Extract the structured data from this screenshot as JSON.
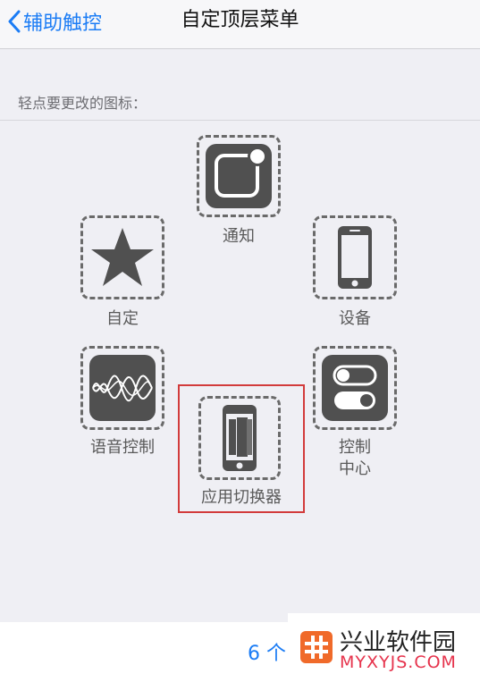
{
  "navbar": {
    "back_label": "辅助触控",
    "title": "自定顶层菜单"
  },
  "section": {
    "label": "轻点要更改的图标："
  },
  "icons": [
    {
      "name": "notification",
      "label": "通知",
      "icon": "notification-icon"
    },
    {
      "name": "custom",
      "label": "自定",
      "icon": "star-icon"
    },
    {
      "name": "device",
      "label": "设备",
      "icon": "phone-icon"
    },
    {
      "name": "siri",
      "label": "语音控制",
      "icon": "waveform-icon"
    },
    {
      "name": "control-center",
      "label_line1": "控制",
      "label_line2": "中心",
      "icon": "toggle-switches-icon"
    },
    {
      "name": "app-switcher",
      "label": "应用切换器",
      "icon": "app-switcher-icon"
    }
  ],
  "count": {
    "label": "6 个"
  },
  "watermark": {
    "name": "兴业软件园",
    "url": "MYXYJS.COM"
  },
  "colors": {
    "accent": "#1b7cf5",
    "icon_tile": "#505050",
    "highlight_border": "#d23b3b"
  }
}
